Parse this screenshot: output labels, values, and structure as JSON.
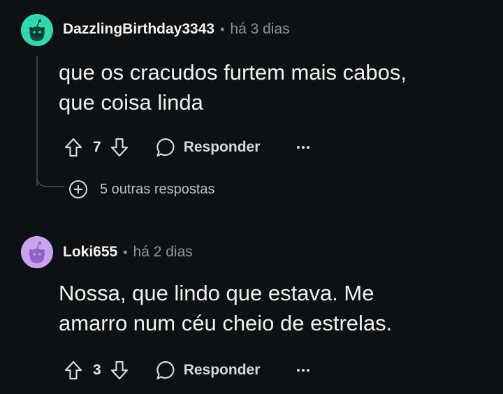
{
  "comments": [
    {
      "username": "DazzlingBirthday3343",
      "separator": "•",
      "time": "há 3 dias",
      "body_lines": [
        "que os cracudos furtem mais cabos,",
        "que coisa linda"
      ],
      "votes": "7",
      "reply_label": "Responder",
      "avatar_color": "#2fd8b0",
      "more_replies_label": "5 outras respostas"
    },
    {
      "username": "Loki655",
      "separator": "•",
      "time": "há 2 dias",
      "body_lines": [
        "Nossa, que lindo que estava. Me",
        "amarro num céu cheio de estrelas."
      ],
      "votes": "3",
      "reply_label": "Responder",
      "avatar_color": "#c9a3f2"
    }
  ],
  "icons": {
    "upvote": "arrow-up-outline-icon",
    "downvote": "arrow-down-outline-icon",
    "comment": "speech-bubble-icon",
    "more": "ellipsis-icon",
    "expand": "plus-circle-icon"
  },
  "theme": {
    "background": "#0e1113",
    "text": "#eef0f1",
    "muted": "#8b9599"
  }
}
